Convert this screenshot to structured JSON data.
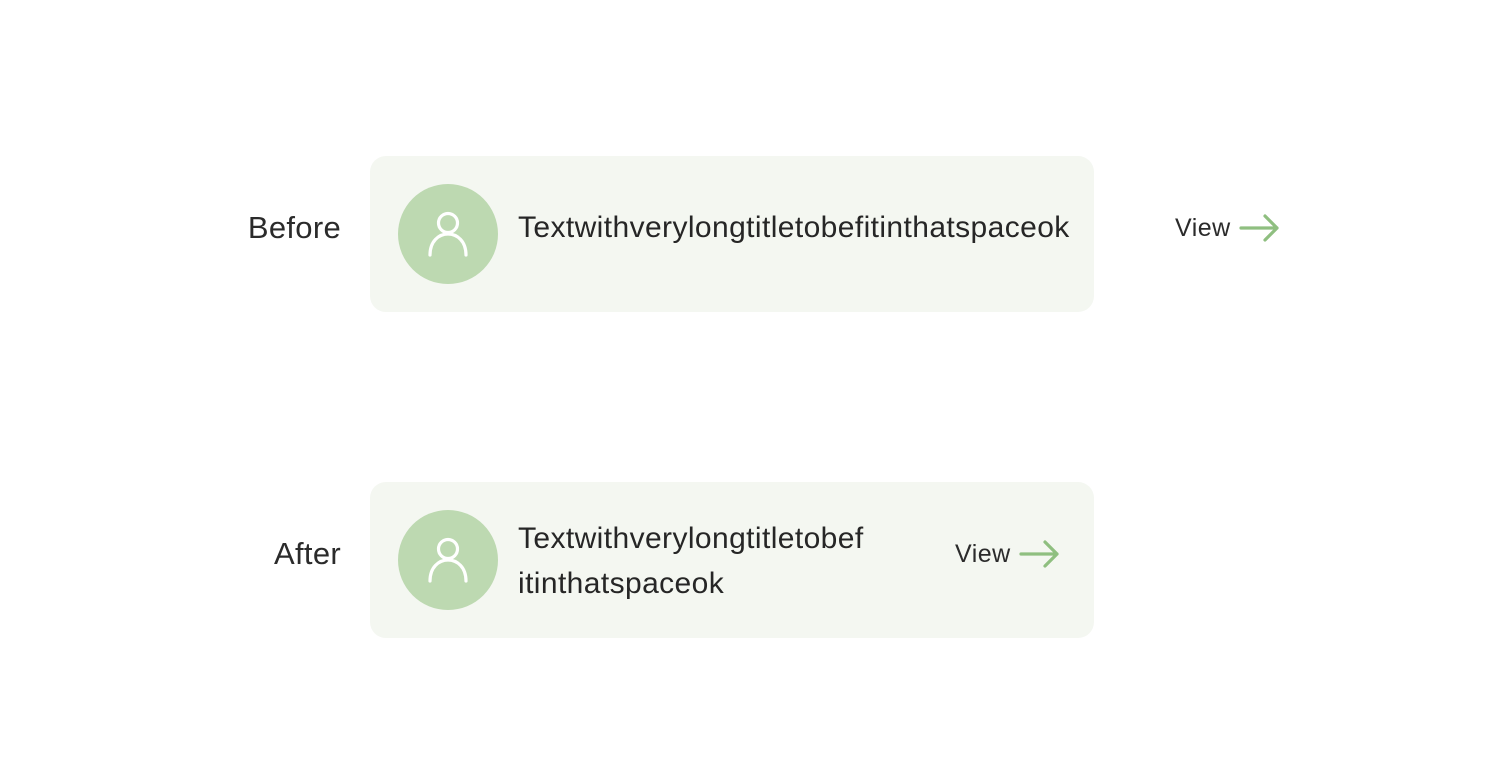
{
  "colors": {
    "card_background": "#f4f7f1",
    "avatar_background": "#bdd9b1",
    "accent": "#8fbf80",
    "text": "#262626"
  },
  "before": {
    "label": "Before",
    "title": "Textwithverylongtitletobefitinthatspaceok",
    "view_label": "View",
    "avatar_icon": "user-icon",
    "action_icon": "arrow-right-icon"
  },
  "after": {
    "label": "After",
    "title_line1": "Textwithverylongtitletobef",
    "title_line2": "itinthatspaceok",
    "view_label": "View",
    "avatar_icon": "user-icon",
    "action_icon": "arrow-right-icon"
  }
}
